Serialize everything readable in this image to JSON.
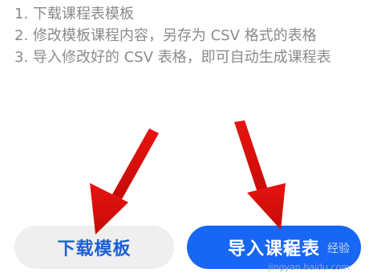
{
  "instructions": [
    "1. 下载课程表模板",
    "2. 修改模板课程内容，另存为 CSV 格式的表格",
    "3. 导入修改好的 CSV 表格，即可自动生成课程表"
  ],
  "buttons": {
    "download_label": "下载模板",
    "import_label": "导入课程表"
  },
  "annotations": {
    "arrow_color": "#e8140f"
  },
  "watermark": {
    "brand": "经验",
    "url": "jingyan.baidu.com"
  },
  "colors": {
    "primary_blue": "#1766f4",
    "secondary_bg": "#efefef",
    "secondary_text": "#1b5fd8",
    "instruction_text": "#8a8a8a"
  }
}
